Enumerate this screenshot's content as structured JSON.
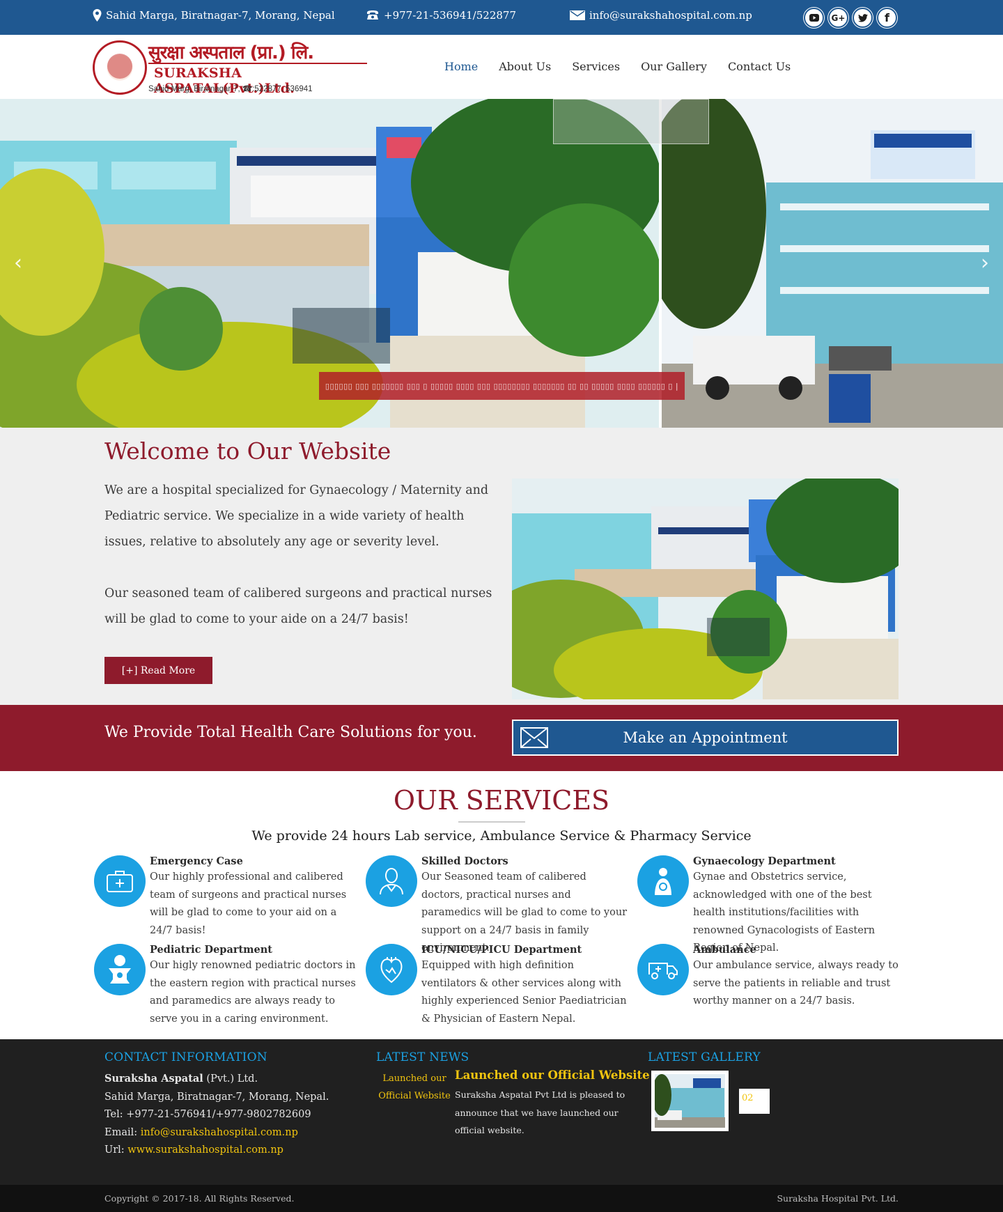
{
  "topbar": {
    "address": "Sahid Marga, Biratnagar-7, Morang, Nepal",
    "phone": "+977-21-536941/522877",
    "email": "info@surakshahospital.com.np",
    "social": [
      "youtube-icon",
      "google-plus-icon",
      "twitter-icon",
      "facebook-icon"
    ]
  },
  "logo": {
    "nepali_name": "सुरक्षा अस्पताल (प्रा.) लि.",
    "english_name": "SURAKSHA ASPATAL(Pvt.)Ltd.",
    "address": "Sahid Marg, Biratnagar-7, ☎:522877, 536941"
  },
  "nav": {
    "items": [
      {
        "label": "Home",
        "active": true
      },
      {
        "label": "About Us"
      },
      {
        "label": "Services"
      },
      {
        "label": "Our Gallery"
      },
      {
        "label": "Contact Us"
      }
    ]
  },
  "slider": {
    "caption": "▯▯▯▯▯▯ ▯▯▯ ▯▯▯▯▯▯▯ ▯▯▯ ▯ ▯▯▯▯▯ ▯▯▯▯ ▯▯▯ ▯▯▯▯▯▯▯▯ ▯▯▯▯▯▯▯ ▯▯ ▯▯ ▯▯▯▯▯ ▯▯▯▯ ▯▯▯▯▯▯ ▯ |",
    "prev": "‹",
    "next": "›"
  },
  "welcome": {
    "title": "Welcome to Our Website",
    "paragraph1": "We are a hospital specialized for Gynaecology / Maternity and Pediatric service. We specialize in a wide variety of health issues, relative to absolutely any age or severity level.",
    "paragraph2": "Our seasoned team of calibered surgeons and practical nurses will be glad to come to your aide on a 24/7 basis!",
    "read_more": "[+] Read More"
  },
  "band": {
    "slogan": "We Provide Total Health Care Solutions for you.",
    "appointment": "Make an Appointment"
  },
  "services": {
    "title": "OUR SERVICES",
    "subtitle": "We provide 24 hours Lab service, Ambulance Service & Pharmacy Service",
    "items": [
      {
        "title": "Emergency Case",
        "desc": "Our highly professional and calibered team of surgeons and practical nurses will be glad to come to your aid on a 24/7 basis!",
        "icon": "first-aid-kit-icon"
      },
      {
        "title": "Skilled Doctors",
        "desc": "Our Seasoned team of calibered doctors, practical nurses and paramedics will be glad to come to your support on a 24/7 basis in family environment.",
        "icon": "doctor-icon"
      },
      {
        "title": "Gynaecology Department",
        "desc": "Gynae and Obstetrics service, acknowledged with one of the best health institutions/facilities with renowned Gynacologists of Eastern Region of Nepal.",
        "icon": "mother-baby-icon"
      },
      {
        "title": "Pediatric Department",
        "desc": "Our higly renowned pediatric doctors in the eastern region with practical nurses and paramedics are always  ready to serve you in a caring environment.",
        "icon": "baby-icon"
      },
      {
        "title": "ICU/NICU/PICU Department",
        "desc": "Equipped with high definition ventilators & other services along with highly experienced Senior Paediatrician & Physician of Eastern Nepal.",
        "icon": "heart-icon"
      },
      {
        "title": "Ambulance",
        "desc": "Our ambulance service,  always ready to serve the patients in reliable and trust worthy manner on a 24/7 basis.",
        "icon": "ambulance-icon"
      }
    ]
  },
  "footer": {
    "contact": {
      "heading": "CONTACT INFORMATION",
      "name_bold": "Suraksha Aspatal",
      "name_rest": " (Pvt.) Ltd.",
      "address": "Sahid Marga, Biratnagar-7, Morang, Nepal.",
      "tel": "Tel: +977-21-576941/+977-9802782609",
      "email_label": "Email: ",
      "email": "info@surakshahospital.com.np",
      "url_label": "Url: ",
      "url": "www.surakshahospital.com.np"
    },
    "news": {
      "heading": "LATEST NEWS",
      "img_alt": "Launched our Official Website",
      "title": "Launched our Official Website",
      "text": "Suraksha Aspatal Pvt Ltd is pleased to announce that we have launched our official website."
    },
    "gallery": {
      "heading": "LATEST GALLERY",
      "broken_alt": "02"
    }
  },
  "copyright": {
    "left": "Copyright © 2017-18. All Rights Reserved.",
    "right": "Suraksha Hospital Pvt. Ltd."
  },
  "colors": {
    "primary_blue": "#1f5891",
    "maroon": "#8e1b2c",
    "service_blue": "#1ba1e2",
    "link_yellow": "#f1c40f"
  }
}
